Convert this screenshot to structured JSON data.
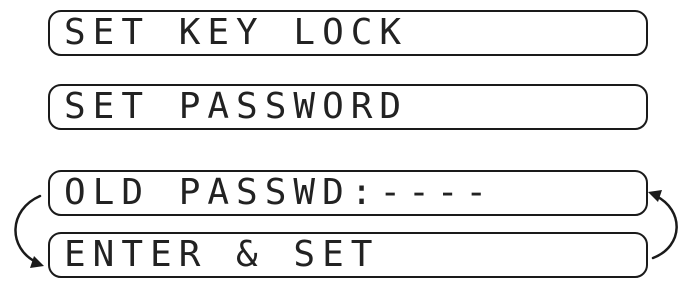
{
  "display": {
    "screens": [
      {
        "text": "SET KEY LOCK"
      },
      {
        "text": "SET PASSWORD"
      },
      {
        "text": "OLD PASSWD:----"
      },
      {
        "text": "ENTER & SET"
      }
    ],
    "cycle_icon": "alternating-display-arrows-icon",
    "colors": {
      "text": "#222222",
      "border": "#1a1a1a",
      "background": "#ffffff"
    }
  }
}
